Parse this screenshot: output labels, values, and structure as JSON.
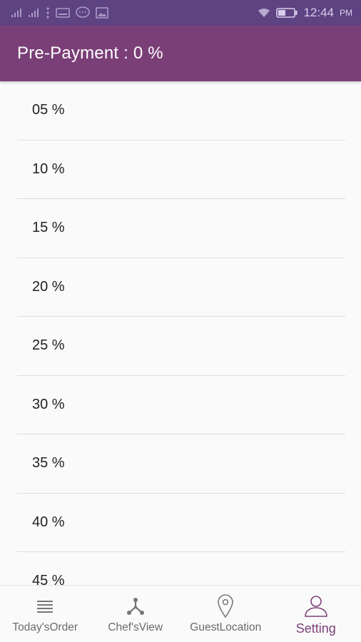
{
  "status_bar": {
    "time": "12:44",
    "ampm": "PM",
    "icons": [
      "signal-icon",
      "signal-icon",
      "more-vert-icon",
      "cast-icon",
      "chat-bubble-icon",
      "image-icon",
      "wifi-icon",
      "battery-icon"
    ]
  },
  "header": {
    "title": "Pre-Payment : 0 %"
  },
  "options": [
    "05 %",
    "10 %",
    "15 %",
    "20 %",
    "25 %",
    "30 %",
    "35 %",
    "40 %",
    "45 %"
  ],
  "bottom_nav": {
    "items": [
      {
        "label": "Today'sOrder",
        "icon": "list-icon",
        "active": false
      },
      {
        "label": "Chef'sView",
        "icon": "share-node-icon",
        "active": false
      },
      {
        "label": "GuestLocation",
        "icon": "location-pin-icon",
        "active": false
      },
      {
        "label": "Setting",
        "icon": "person-icon",
        "active": true
      }
    ]
  },
  "colors": {
    "status_bar": "#5e4383",
    "app_bar": "#7b3f78",
    "active_nav": "#7b3f78",
    "inactive_nav": "#6b6b6b"
  }
}
